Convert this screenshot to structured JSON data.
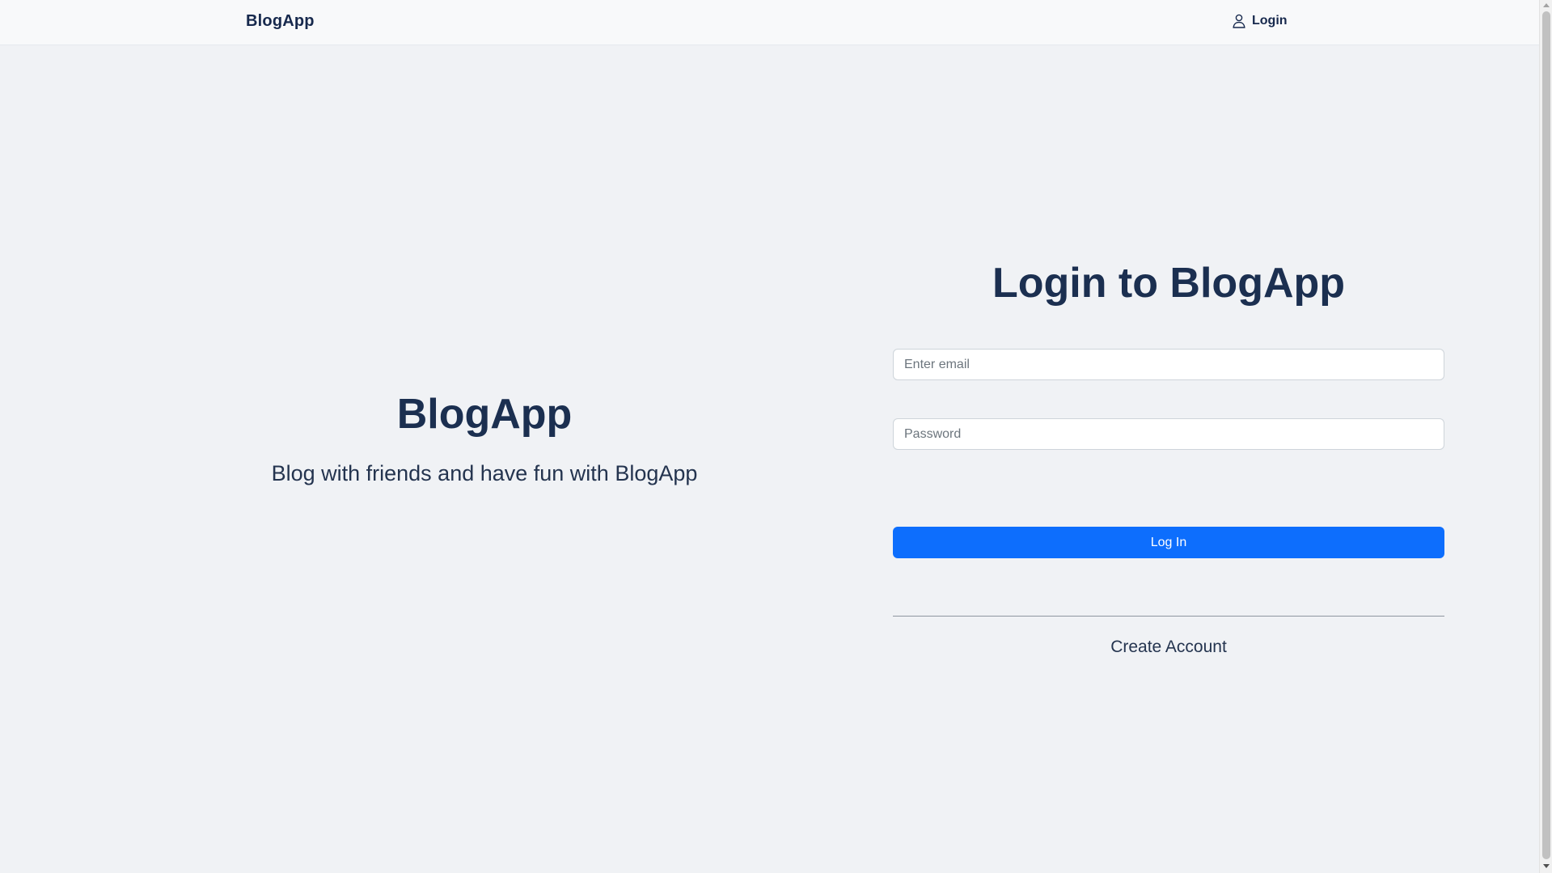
{
  "navbar": {
    "brand": "BlogApp",
    "login_label": "Login",
    "login_icon": "user-icon"
  },
  "hero": {
    "title": "BlogApp",
    "subtitle": "Blog with friends and have fun with BlogApp"
  },
  "login_form": {
    "title": "Login to BlogApp",
    "email": {
      "value": "",
      "placeholder": "Enter email"
    },
    "password": {
      "value": "",
      "placeholder": "Password"
    },
    "submit_label": "Log In",
    "create_account_label": "Create Account"
  },
  "colors": {
    "background": "#f0f2f5",
    "navbar": "#f8f9fa",
    "primary_button": "#0d6efd",
    "heading_text": "#1b2f50"
  }
}
